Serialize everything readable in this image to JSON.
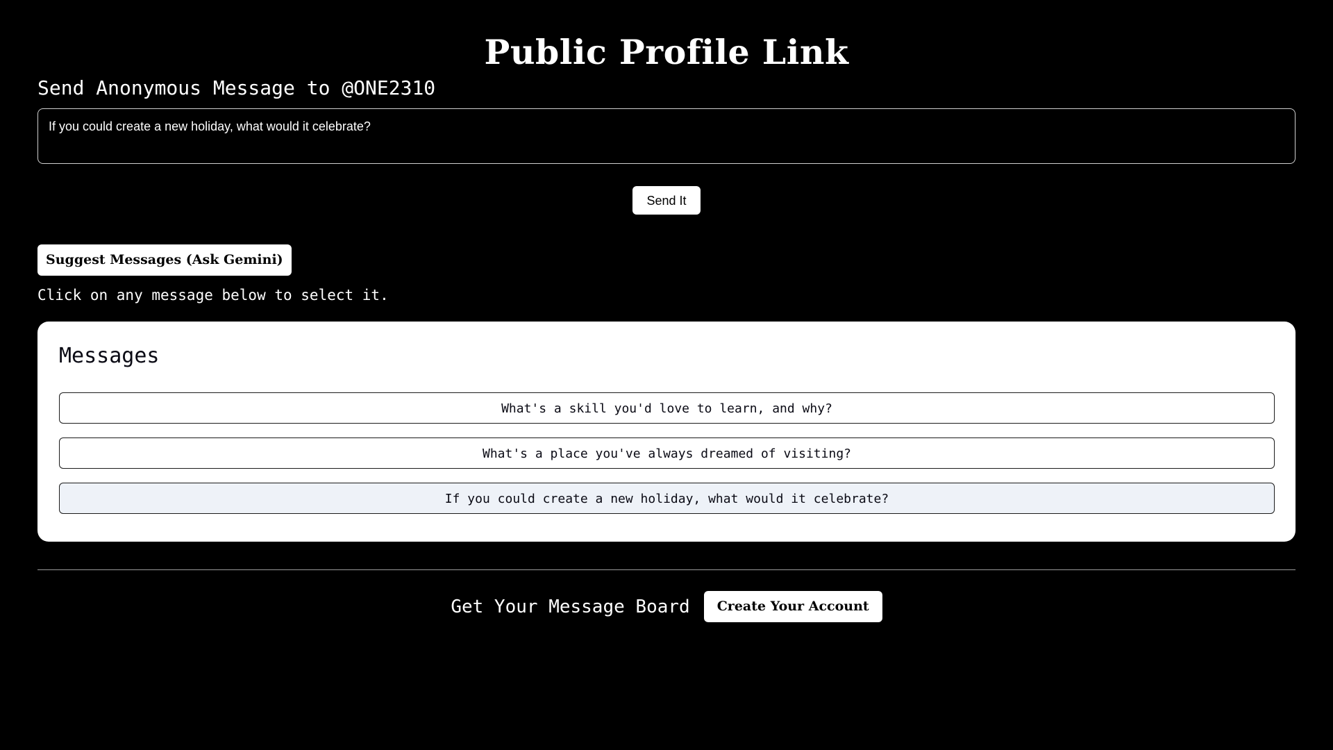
{
  "header": {
    "title": "Public Profile Link"
  },
  "send_form": {
    "heading": "Send Anonymous Message to @ONE2310",
    "message_value": "If you could create a new holiday, what would it celebrate?",
    "send_label": "Send It"
  },
  "suggest": {
    "button_label": "Suggest Messages (Ask Gemini)",
    "hint": "Click on any message below to select it."
  },
  "messages": {
    "title": "Messages",
    "items": [
      {
        "text": "What's a skill you'd love to learn, and why?",
        "selected": false
      },
      {
        "text": "What's a place you've always dreamed of visiting?",
        "selected": false
      },
      {
        "text": "If you could create a new holiday, what would it celebrate?",
        "selected": true
      }
    ]
  },
  "footer": {
    "text": "Get Your Message Board",
    "create_label": "Create Your Account"
  },
  "colors": {
    "background": "#000000",
    "foreground": "#ffffff",
    "selected_item_bg": "#eef2f8"
  }
}
